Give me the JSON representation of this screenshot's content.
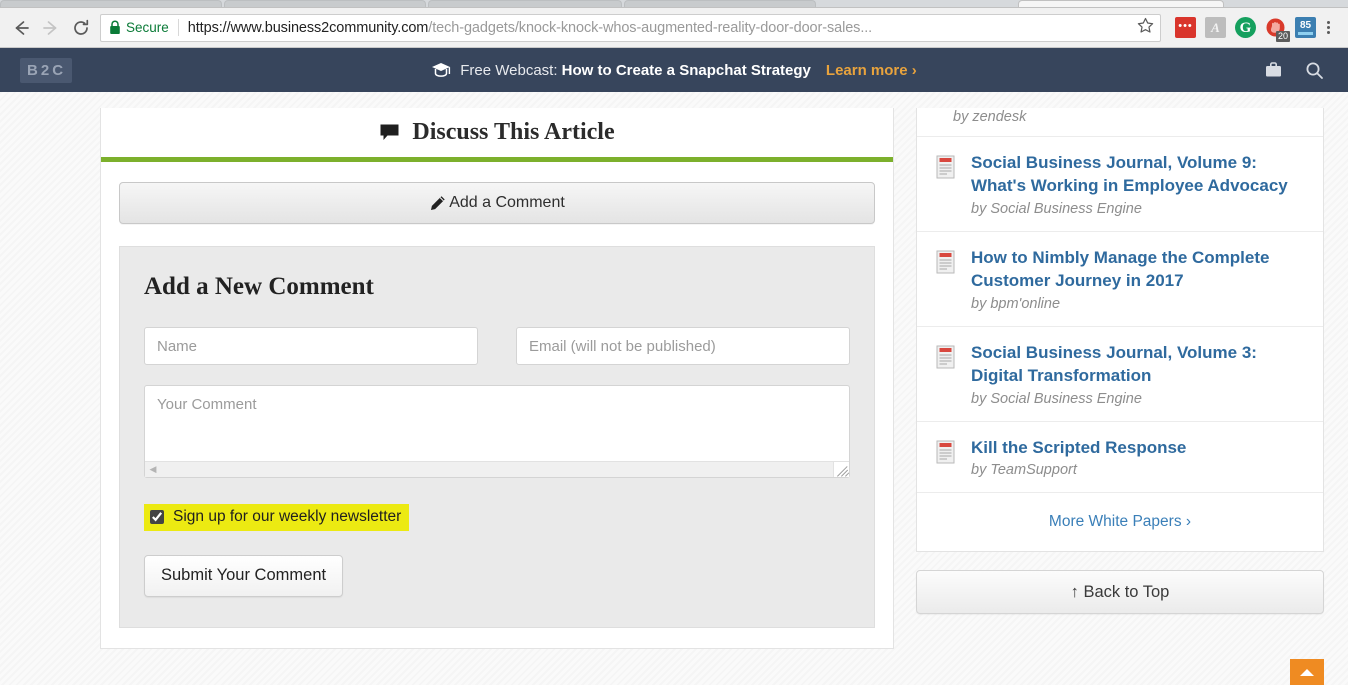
{
  "browser": {
    "back_icon": "back-arrow-icon",
    "forward_icon": "forward-arrow-icon",
    "reload_icon": "reload-icon",
    "security_label": "Secure",
    "url_scheme_host": "https://www.business2community.com",
    "url_path": "/tech-gadgets/knock-knock-whos-augmented-reality-door-door-sales...",
    "bookmark_icon": "star-icon",
    "extensions": [
      {
        "name": "lastpass-extension-icon",
        "glyph": "•••",
        "badge": ""
      },
      {
        "name": "adobe-acrobat-extension-icon",
        "glyph": "A",
        "badge": ""
      },
      {
        "name": "grammarly-extension-icon",
        "glyph": "G",
        "badge": ""
      },
      {
        "name": "adblock-extension-icon",
        "glyph": "✋",
        "badge": "20"
      },
      {
        "name": "page-score-extension-icon",
        "glyph": "85",
        "badge": ""
      }
    ],
    "menu_icon": "three-dot-menu-icon"
  },
  "site_nav": {
    "logo_parts": [
      "B",
      "2",
      "C"
    ],
    "webcast_icon": "graduation-cap-icon",
    "webcast_prefix": "Free Webcast:",
    "webcast_title": "How to Create a Snapchat Strategy",
    "learn_more": "Learn more ›",
    "briefcase_icon": "briefcase-icon",
    "search_icon": "search-icon"
  },
  "discuss": {
    "icon": "speech-bubble-icon",
    "title": "Discuss This Article",
    "accent_color": "#7cb02c",
    "add_comment_icon": "pencil-icon",
    "add_comment_label": "Add a Comment"
  },
  "comment_form": {
    "title": "Add a New Comment",
    "name_placeholder": "Name",
    "name_value": "",
    "email_placeholder": "Email (will not be published)",
    "email_value": "",
    "comment_placeholder": "Your Comment",
    "comment_value": "",
    "newsletter_label": "Sign up for our weekly newsletter",
    "newsletter_checked": true,
    "newsletter_highlight_color": "#ecea12",
    "submit_label": "Submit Your Comment"
  },
  "sidebar": {
    "partial_top_byline": "by zendesk",
    "white_papers": [
      {
        "icon": "white-paper-document-icon",
        "title": "Social Business Journal, Volume 9: What's Working in Employee Advocacy",
        "byline": "by Social Business Engine"
      },
      {
        "icon": "white-paper-document-icon",
        "title": "How to Nimbly Manage the Complete Customer Journey in 2017",
        "byline": "by bpm'online"
      },
      {
        "icon": "white-paper-document-icon",
        "title": "Social Business Journal, Volume 3: Digital Transformation",
        "byline": "by Social Business Engine"
      },
      {
        "icon": "white-paper-document-icon",
        "title": "Kill the Scripted Response",
        "byline": "by TeamSupport"
      }
    ],
    "more_link": "More White Papers ›",
    "back_to_top_label": "↑ Back to Top",
    "scroll_top_fab_icon": "scroll-to-top-icon"
  }
}
